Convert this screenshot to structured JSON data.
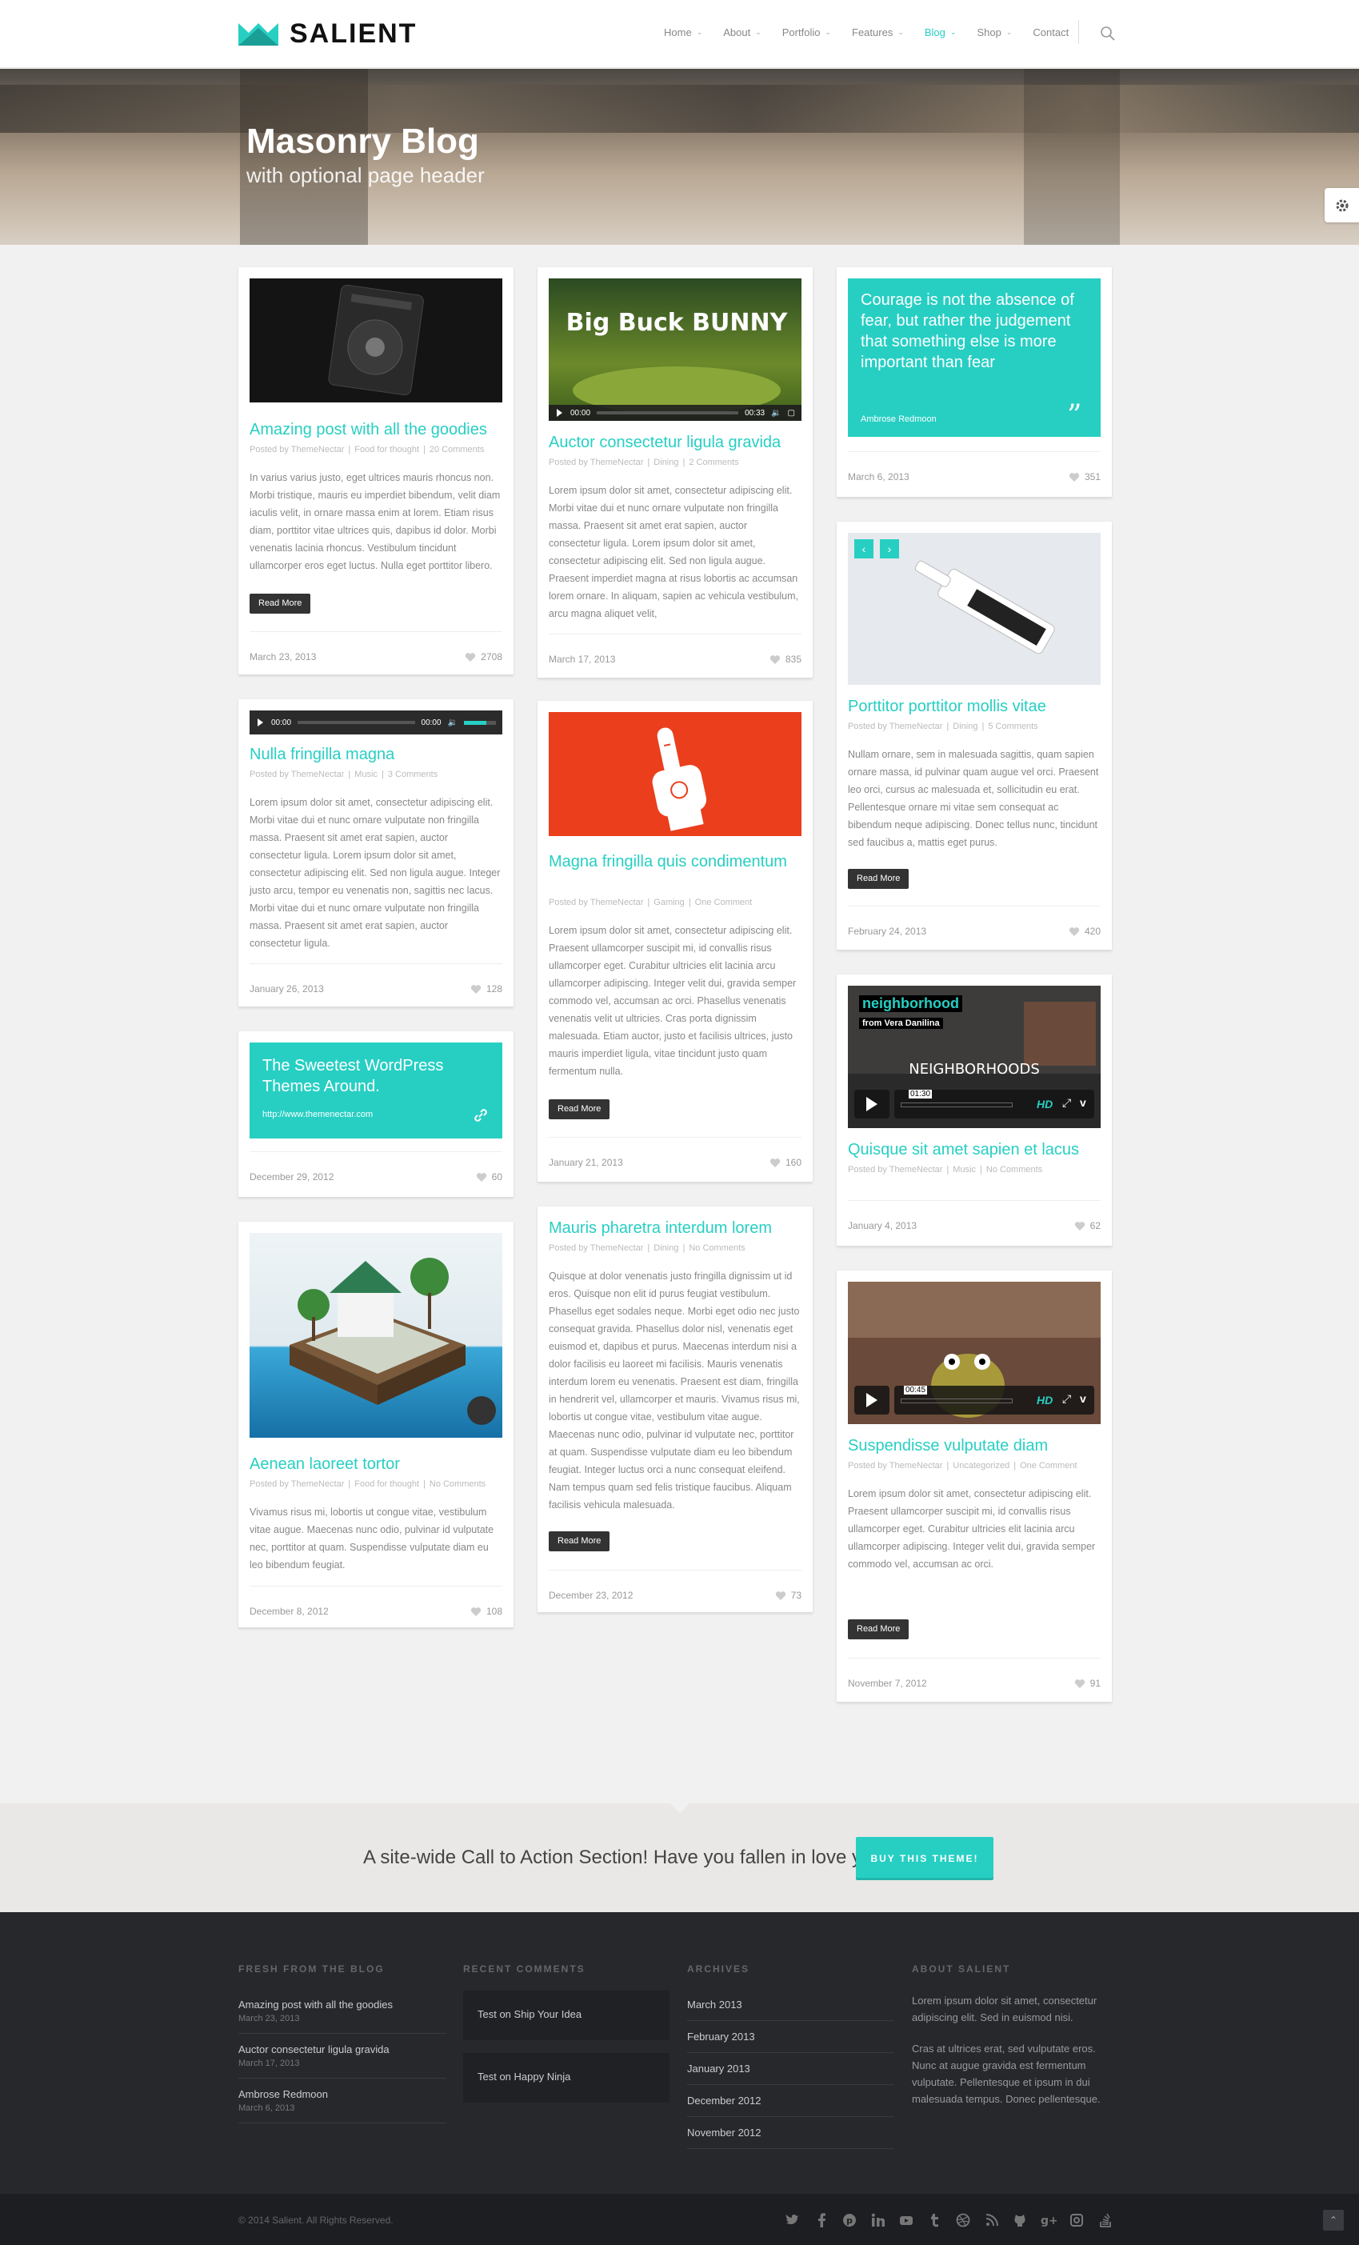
{
  "brand": {
    "name": "SALIENT",
    "accent": "#27cfc3"
  },
  "nav": [
    {
      "label": "Home",
      "dropdown": true,
      "active": false
    },
    {
      "label": "About",
      "dropdown": true,
      "active": false
    },
    {
      "label": "Portfolio",
      "dropdown": true,
      "active": false
    },
    {
      "label": "Features",
      "dropdown": true,
      "active": false
    },
    {
      "label": "Blog",
      "dropdown": true,
      "active": true
    },
    {
      "label": "Shop",
      "dropdown": true,
      "active": false
    },
    {
      "label": "Contact",
      "dropdown": false,
      "active": false
    }
  ],
  "hero": {
    "title": "Masonry Blog",
    "subtitle": "with optional page header"
  },
  "posts": {
    "p1": {
      "title": "Amazing post with all the goodies",
      "author": "Posted by ThemeNectar",
      "category": "Food for thought",
      "comments": "20 Comments",
      "excerpt": "In varius varius justo, eget ultrices mauris rhoncus non. Morbi tristique, mauris eu imperdiet bibendum, velit diam iaculis velit, in ornare massa enim at lorem. Etiam risus diam, porttitor vitae ultrices quis, dapibus id dolor. Morbi venenatis lacinia rhoncus. Vestibulum tincidunt ullamcorper eros eget luctus. Nulla eget porttitor libero.",
      "date": "March 23, 2013",
      "likes": "2708"
    },
    "p2": {
      "title": "Auctor consectetur ligula gravida",
      "author": "Posted by ThemeNectar",
      "category": "Dining",
      "comments": "2 Comments",
      "excerpt": "Lorem ipsum dolor sit amet, consectetur adipiscing elit. Morbi vitae dui et nunc ornare vulputate non fringilla massa. Praesent sit amet erat sapien, auctor consectetur ligula. Lorem ipsum dolor sit amet, consectetur adipiscing elit. Sed non ligula augue. Praesent imperdiet magna at risus lobortis ac accumsan lorem ornare. In aliquam, sapien ac vehicula vestibulum, arcu magna aliquet velit,",
      "date": "March 17, 2013",
      "likes": "835",
      "video_time": "00:00",
      "video_total": "00:33",
      "video_title": "Big Buck BUNNY"
    },
    "p3": {
      "quote": "Courage is not the absence of fear, but rather the judgement that something else is more important than fear",
      "author": "Ambrose Redmoon",
      "date": "March 6, 2013",
      "likes": "351"
    },
    "p4": {
      "title": "Nulla fringilla magna",
      "author": "Posted by ThemeNectar",
      "category": "Music",
      "comments": "3 Comments",
      "excerpt": "Lorem ipsum dolor sit amet, consectetur adipiscing elit. Morbi vitae dui et nunc ornare vulputate non fringilla massa. Praesent sit amet erat sapien, auctor consectetur ligula. Lorem ipsum dolor sit amet, consectetur adipiscing elit. Sed non ligula augue. Integer justo arcu, tempor eu venenatis non, sagittis nec lacus. Morbi vitae dui et nunc ornare vulputate non fringilla massa. Praesent sit amet erat sapien, auctor consectetur ligula.",
      "date": "January 26, 2013",
      "likes": "128",
      "audio_time": "00:00",
      "audio_total": "00:00",
      "volume": 0.7
    },
    "p5": {
      "title": "Magna fringilla quis condimentum",
      "author": "Posted by ThemeNectar",
      "category": "Gaming",
      "comments": "One Comment",
      "excerpt": "Lorem ipsum dolor sit amet, consectetur adipiscing elit. Praesent ullamcorper suscipit mi, id convallis risus ullamcorper eget. Curabitur ultricies elit lacinia arcu ullamcorper adipiscing. Integer velit dui, gravida semper commodo vel, accumsan ac orci. Phasellus venenatis venenatis velit ut ultricies. Cras porta dignissim malesuada. Etiam auctor, justo et facilisis ultrices, justo mauris imperdiet ligula, vitae tincidunt justo quam fermentum nulla.",
      "date": "January 21, 2013",
      "likes": "160"
    },
    "p6": {
      "title": "Porttitor porttitor mollis vitae",
      "author": "Posted by ThemeNectar",
      "category": "Dining",
      "comments": "5 Comments",
      "excerpt": "Nullam ornare, sem in malesuada sagittis, quam sapien ornare massa, id pulvinar quam augue vel orci. Praesent leo orci, cursus ac malesuada et, sollicitudin eu erat. Pellentesque ornare mi vitae sem consequat ac bibendum neque adipiscing. Donec tellus nunc, tincidunt sed faucibus a, mattis eget purus.",
      "date": "February 24, 2013",
      "likes": "420"
    },
    "p7": {
      "link_title": "The Sweetest WordPress Themes Around.",
      "url": "http://www.themenectar.com",
      "date": "December 29, 2012",
      "likes": "60"
    },
    "p8": {
      "title": "Mauris pharetra interdum lorem",
      "author": "Posted by ThemeNectar",
      "category": "Dining",
      "comments": "No Comments",
      "excerpt": "Quisque at dolor venenatis justo fringilla dignissim ut id eros. Quisque non elit id purus feugiat vestibulum. Phasellus eget sodales neque. Morbi eget odio nec justo consequat gravida. Phasellus dolor nisl, venenatis eget euismod et, dapibus et purus. Maecenas interdum nisi a dolor facilisis eu laoreet mi facilisis. Mauris venenatis interdum lorem eu venenatis. Praesent est diam, fringilla in hendrerit vel, ullamcorper et mauris. Vivamus risus mi, lobortis ut congue vitae, vestibulum vitae augue. Maecenas nunc odio, pulvinar id vulputate nec, porttitor at quam. Suspendisse vulputate diam eu leo bibendum feugiat. Integer luctus orci a nunc consequat eleifend. Nam tempus quam sed felis tristique faucibus. Aliquam facilisis vehicula malesuada.",
      "date": "December 23, 2012",
      "likes": "73"
    },
    "p9": {
      "title": "Quisque sit amet sapien et lacus",
      "author": "Posted by ThemeNectar",
      "category": "Music",
      "comments": "No Comments",
      "date": "January 4, 2013",
      "likes": "62",
      "video_title": "neighborhood",
      "video_sub": "from Vera Danilina",
      "video_caption": "NEIGHBORHOODS",
      "video_time": "01:30",
      "hd": "HD"
    },
    "p10": {
      "title": "Aenean laoreet tortor",
      "author": "Posted by ThemeNectar",
      "category": "Food for thought",
      "comments": "No Comments",
      "excerpt": "Vivamus risus mi, lobortis ut congue vitae, vestibulum vitae augue. Maecenas nunc odio, pulvinar id vulputate nec, porttitor at quam. Suspendisse vulputate diam eu leo bibendum feugiat.",
      "date": "December 8, 2012",
      "likes": "108"
    },
    "p11": {
      "title": "Suspendisse vulputate diam",
      "author": "Posted by ThemeNectar",
      "category": "Uncategorized",
      "comments": "One Comment",
      "excerpt": "Lorem ipsum dolor sit amet, consectetur adipiscing elit. Praesent ullamcorper suscipit mi, id convallis risus ullamcorper eget. Curabitur ultricies elit lacinia arcu ullamcorper adipiscing. Integer velit dui, gravida semper commodo vel, accumsan ac orci.",
      "date": "November 7, 2012",
      "likes": "91",
      "video_time": "00:45",
      "hd": "HD"
    }
  },
  "read_more": "Read More",
  "cta": {
    "text": "A site-wide Call to Action Section! Have you fallen in love yet?",
    "button": "BUY THIS THEME!"
  },
  "footer": {
    "blog_head": "FRESH FROM THE BLOG",
    "blog": [
      {
        "title": "Amazing post with all the goodies",
        "date": "March 23, 2013"
      },
      {
        "title": "Auctor consectetur ligula gravida",
        "date": "March 17, 2013"
      },
      {
        "title": "Ambrose Redmoon",
        "date": "March 6, 2013"
      }
    ],
    "comments_head": "RECENT COMMENTS",
    "comments": [
      "Test on Ship Your Idea",
      "Test on Happy Ninja"
    ],
    "archives_head": "ARCHIVES",
    "archives": [
      "March 2013",
      "February 2013",
      "January 2013",
      "December 2012",
      "November 2012"
    ],
    "about_head": "ABOUT SALIENT",
    "about": [
      "Lorem ipsum dolor sit amet, consectetur adipiscing elit. Sed in euismod nisi.",
      "Cras at ultrices erat, sed vulputate eros. Nunc at augue gravida est fermentum vulputate. Pellentesque et ipsum in dui malesuada tempus. Donec pellentesque."
    ]
  },
  "copyright": "© 2014 Salient. All Rights Reserved.",
  "social_icons": [
    "twitter-icon",
    "facebook-icon",
    "pinterest-icon",
    "linkedin-icon",
    "youtube-icon",
    "tumblr-icon",
    "dribbble-icon",
    "rss-icon",
    "github-icon",
    "google-plus-icon",
    "instagram-icon",
    "stackexchange-icon"
  ]
}
